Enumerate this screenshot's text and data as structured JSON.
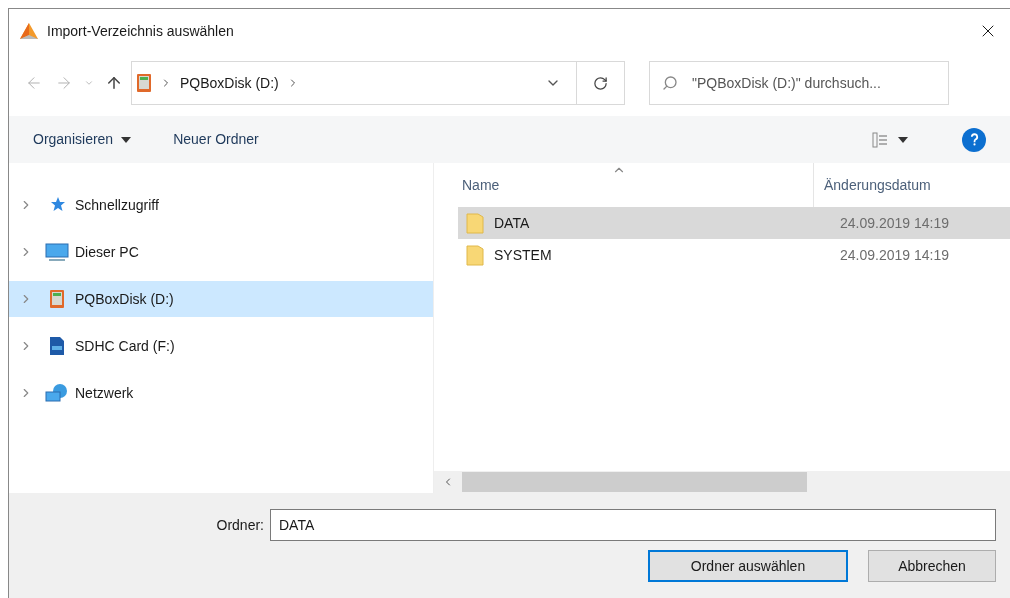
{
  "window": {
    "title": "Import-Verzeichnis auswählen"
  },
  "address_bar": {
    "segments": [
      "PQBoxDisk (D:)"
    ]
  },
  "search": {
    "placeholder": "\"PQBoxDisk (D:)\" durchsuch..."
  },
  "toolbar": {
    "organize": "Organisieren",
    "new_folder": "Neuer Ordner"
  },
  "sidebar": {
    "items": [
      {
        "label": "Schnellzugriff",
        "kind": "star",
        "selected": false
      },
      {
        "label": "Dieser PC",
        "kind": "pc",
        "selected": false
      },
      {
        "label": "PQBoxDisk (D:)",
        "kind": "device",
        "selected": true
      },
      {
        "label": "SDHC Card (F:)",
        "kind": "sdcard",
        "selected": false
      },
      {
        "label": "Netzwerk",
        "kind": "network",
        "selected": false
      }
    ]
  },
  "file_list": {
    "columns": [
      "Name",
      "Änderungsdatum"
    ],
    "rows": [
      {
        "name": "DATA",
        "date": "24.09.2019 14:19",
        "selected": true
      },
      {
        "name": "SYSTEM",
        "date": "24.09.2019 14:19",
        "selected": false
      }
    ]
  },
  "folder_field": {
    "label": "Ordner:",
    "value": "DATA"
  },
  "buttons": [
    {
      "label": "Ordner auswählen",
      "kind": "primary"
    },
    {
      "label": "Abbrechen",
      "kind": "secondary"
    }
  ]
}
